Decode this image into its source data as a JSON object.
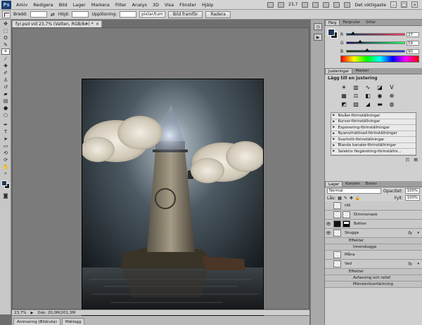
{
  "menu": {
    "logo": "Ps",
    "items": [
      "Arkiv",
      "Redigera",
      "Bild",
      "Lager",
      "Markera",
      "Filter",
      "Analys",
      "3D",
      "Visa",
      "Fönster",
      "Hjälp"
    ],
    "zoom": "23,7",
    "workspace": "Det viktigaste"
  },
  "options": {
    "width_label": "Bredd:",
    "height_label": "Höjd:",
    "resolution_label": "Upplösning:",
    "resolution_unit": "pixlar/tum",
    "front_image_btn": "Bild framför",
    "clear_btn": "Radera"
  },
  "document": {
    "tab_title": "fyr.psd vid 23,7% (Vatten, RGB/8#) *",
    "status_zoom": "23,7%",
    "status_doc": "Dok: 20,0M/201,3M"
  },
  "bottom_tabs": [
    "Animering (Bildruta)",
    "Mätlogg"
  ],
  "color_panel": {
    "tabs": [
      "Färg",
      "Färgrutor",
      "Stilar"
    ],
    "r": "27",
    "g": "59",
    "b": "90",
    "r_frac": 0.11,
    "g_frac": 0.23,
    "b_frac": 0.35,
    "fg_color": "#1d3859",
    "bg_color": "#222222"
  },
  "adjust_panel": {
    "tabs": [
      "Justeringar",
      "Masker"
    ],
    "title": "Lägg till en justering",
    "presets": [
      "Nivåer-förinställningar",
      "Kurvor-förinställningar",
      "Exponering-förinställningar",
      "Nyans/mättnad-förinställningar",
      "Svartvitt-förinställningar",
      "Blanda kanaler-förinställningar",
      "Selektiv färgändring-förinställni..."
    ]
  },
  "layers_panel": {
    "tabs": [
      "Lager",
      "Kanaler",
      "Banor"
    ],
    "blend_mode": "Normal",
    "opacity_label": "Opacitet:",
    "opacity": "100%",
    "lock_label": "Lås:",
    "fill_label": "Fyll:",
    "fill": "100%",
    "rows": [
      {
        "name": "rök",
        "sub": false,
        "fx": ""
      },
      {
        "name": "Dimmsmask",
        "sub": false,
        "fx": ""
      },
      {
        "name": "Botten",
        "sub": false,
        "fx": ""
      },
      {
        "name": "Skugga",
        "sub": false,
        "fx": "fx"
      },
      {
        "name": "Effekter",
        "sub": true,
        "fx": ""
      },
      {
        "name": "Innerskugga",
        "sub": true,
        "fx": ""
      },
      {
        "name": "Måna",
        "sub": false,
        "fx": ""
      },
      {
        "name": "Vad",
        "sub": false,
        "fx": "fx"
      },
      {
        "name": "Effekter",
        "sub": true,
        "fx": ""
      },
      {
        "name": "Avfasning och relief",
        "sub": true,
        "fx": ""
      },
      {
        "name": "Mönsterövertäckning",
        "sub": true,
        "fx": ""
      }
    ]
  }
}
